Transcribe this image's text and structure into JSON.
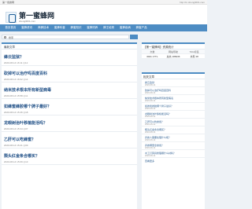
{
  "topbar": {
    "left": "第一蜜蜂网",
    "right": "http://m.shengli001.com"
  },
  "logo": {
    "title": "第一蜜蜂网",
    "subtitle": "shengli001.com"
  },
  "nav": [
    "首页首页",
    "蜜蜂资讯",
    "养蜂技术",
    "蜜蜂科普",
    "蜂蜜知识",
    "蜜蜂饲养",
    "蜂王培育",
    "蜜蜂疾病",
    "蜂蜜产品"
  ],
  "search": {
    "value": "搜索"
  },
  "main": {
    "heading": "最新文章",
    "posts": [
      {
        "title": "蜂云监狱？",
        "meta": "2020-08-14 16:11  ◎12"
      },
      {
        "title": "砍掉可以治疗吗百度百科",
        "meta": "2020-08-14 16:02  ◎14"
      },
      {
        "title": "纳米技术根本所有新型病毒",
        "meta": "2020-08-14 15:58  ◎11"
      },
      {
        "title": "如蜂蜜蜂胶哪个牌子最好？",
        "meta": "2020-08-14 15:46  ◎18"
      },
      {
        "title": "龙眼树治叶移植能活吗？",
        "meta": "2020-08-14 15:34  ◎07"
      },
      {
        "title": "乙肝可以吃蜂蜜？",
        "meta": "2020-08-14 15:21  ◎09"
      },
      {
        "title": "颓头红金条合哪买？",
        "meta": "2020-08-14 15:09  ◎13"
      }
    ]
  },
  "side_stats": {
    "heading": "【第一蜜蜂网】资源统计",
    "labels": [
      "文章",
      "网站导航",
      "TAG标签"
    ],
    "values": [
      "3021 17TL",
      "总共 186936",
      "共有 48"
    ]
  },
  "side_list": {
    "heading": "相关文章",
    "items": [
      {
        "title": "蜂云监狱",
        "meta": "2020-08-14"
      },
      {
        "title": "砍掉可以治疗吗百度百科",
        "meta": "2020-08-14"
      },
      {
        "title": "纳米技术根本所有新型病毒",
        "meta": "2020-08-14"
      },
      {
        "title": "如蜂蜜蜂胶哪个牌子最好？",
        "meta": "2020-08-14"
      },
      {
        "title": "龙眼树治叶移植能活吗？",
        "meta": "2020-08-14"
      },
      {
        "title": "乙肝可以吃蜂蜜？",
        "meta": "2020-08-14"
      },
      {
        "title": "颓头红金条合哪买？",
        "meta": "2020-08-14"
      },
      {
        "title": "养蜂人需要处理什么呢？",
        "meta": "2020-08-14"
      },
      {
        "title": "养蜂哪里拿蜂蜜？",
        "meta": "2020-08-14"
      },
      {
        "title": "木工打算具修理哪什么材料？",
        "meta": "2020-08-14"
      }
    ],
    "more": "查看更多"
  }
}
